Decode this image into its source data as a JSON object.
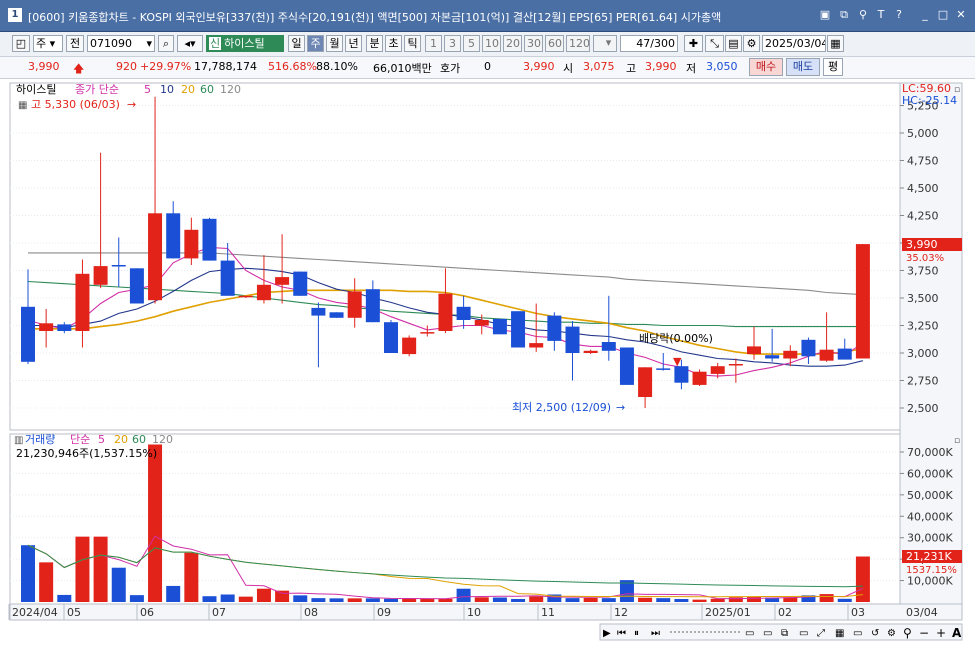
{
  "title_bar": {
    "badge": "1",
    "text": "[0600] 키움종합차트 - KOSPI 외국인보유[337(천)] 주식수[20,191(천)] 액면[500] 자본금[101(억)] 결산[12월] EPS[65] PER[61.64] 시가총액",
    "icons": [
      "window-layout-icon",
      "window-cascade-icon",
      "link-icon",
      "font-icon",
      "help-icon",
      "minimize-icon",
      "maximize-icon",
      "close-icon"
    ]
  },
  "toolbar": {
    "market": "주",
    "prev_label": "전",
    "code": "071090",
    "new_badge": "신",
    "stock_name": "하이스틸",
    "period_tabs": [
      "일",
      "주",
      "월",
      "년"
    ],
    "active_period": "주",
    "minute_tabs": [
      "분",
      "초",
      "틱"
    ],
    "interval_values": [
      "1",
      "3",
      "5",
      "10",
      "20",
      "30",
      "60",
      "120"
    ],
    "count": "47",
    "count_total": "/300",
    "date": "2025/03/04"
  },
  "quote": {
    "price": "3,990",
    "change": "920",
    "change_rate": "+29.97%",
    "volume": "17,788,174",
    "vol_ratio": "516.68%",
    "turnover": "88.10%",
    "amount": "66,010백만",
    "hoga_label": "호가",
    "hoga_value": "0",
    "hoga_price": "3,990",
    "open_label": "시",
    "open": "3,075",
    "high_label": "고",
    "high": "3,990",
    "low_label": "저",
    "low": "3,050",
    "buy_label": "매수",
    "sell_label": "매도",
    "eval_label": "평"
  },
  "price_panel": {
    "stock_label": "하이스틸",
    "ma_prefix": "종가 단순",
    "ma_labels": [
      "5",
      "10",
      "20",
      "60",
      "120"
    ],
    "high_note": "고 5,330 (06/03)",
    "low_note": "최저 2,500 (12/09)",
    "dividend_note": "배당락(0.00%)",
    "lc": "LC:59.60",
    "hc": "HC:-25.14",
    "last_price": "3,990",
    "last_change": "35.03%"
  },
  "volume_panel": {
    "label": "거래량",
    "ma_prefix": "단순",
    "ma_labels": [
      "5",
      "20",
      "60",
      "120"
    ],
    "info": "21,230,946주(1,537.15%)",
    "last_volume": "21,231K",
    "last_ratio": "1537.15%"
  },
  "x_axis": [
    "2024/04",
    "05",
    "06",
    "07",
    "08",
    "09",
    "10",
    "11",
    "12",
    "2025/01",
    "02",
    "03",
    "03/04"
  ],
  "colors": {
    "up": "#e2231a",
    "down": "#1a4fd6",
    "ma5": "#d12fa6",
    "ma10": "#23388c",
    "ma20": "#e0a100",
    "ma60": "#2e8b57",
    "ma120": "#8a8a8a"
  },
  "chart_data": {
    "type": "candlestick",
    "price_axis_ticks": [
      "5,250",
      "5,000",
      "4,750",
      "4,500",
      "4,250",
      "4,000",
      "3,750",
      "3,500",
      "3,250",
      "3,000",
      "2,750",
      "2,500"
    ],
    "volume_axis_ticks": [
      "70,000K",
      "60,000K",
      "50,000K",
      "40,000K",
      "30,000K",
      "20,000K",
      "10,000K"
    ],
    "candles": [
      [
        3420,
        3760,
        2900,
        2920
      ],
      [
        3200,
        3400,
        3050,
        3270
      ],
      [
        3260,
        3280,
        3180,
        3200
      ],
      [
        3200,
        3850,
        3050,
        3720
      ],
      [
        3620,
        4820,
        3590,
        3790
      ],
      [
        3800,
        4050,
        3600,
        3790
      ],
      [
        3770,
        3770,
        3450,
        3450
      ],
      [
        3480,
        5330,
        3450,
        4270
      ],
      [
        4270,
        4380,
        3860,
        3860
      ],
      [
        3860,
        4230,
        3800,
        4120
      ],
      [
        4220,
        4230,
        3840,
        3840
      ],
      [
        3840,
        4000,
        3530,
        3520
      ],
      [
        3510,
        3520,
        3500,
        3520
      ],
      [
        3480,
        3890,
        3450,
        3620
      ],
      [
        3620,
        4080,
        3450,
        3690
      ],
      [
        3740,
        3740,
        3520,
        3520
      ],
      [
        3410,
        3460,
        2870,
        3340
      ],
      [
        3370,
        3370,
        3320,
        3320
      ],
      [
        3320,
        3680,
        3230,
        3560
      ],
      [
        3580,
        3660,
        3280,
        3280
      ],
      [
        3280,
        3300,
        3000,
        3000
      ],
      [
        2990,
        3160,
        2970,
        3140
      ],
      [
        3190,
        3250,
        3150,
        3190
      ],
      [
        3200,
        3770,
        3180,
        3540
      ],
      [
        3420,
        3520,
        3220,
        3300
      ],
      [
        3250,
        3350,
        3170,
        3300
      ],
      [
        3310,
        3310,
        3190,
        3170
      ],
      [
        3380,
        3380,
        3050,
        3050
      ],
      [
        3050,
        3450,
        3010,
        3090
      ],
      [
        3340,
        3370,
        3020,
        3110
      ],
      [
        3240,
        3290,
        2750,
        3000
      ],
      [
        3000,
        3030,
        2990,
        3020
      ],
      [
        3100,
        3520,
        2930,
        3020
      ],
      [
        3050,
        3050,
        2740,
        2710
      ],
      [
        2600,
        2870,
        2500,
        2870
      ],
      [
        2860,
        3000,
        2840,
        2850
      ],
      [
        2880,
        2940,
        2670,
        2730
      ],
      [
        2710,
        2850,
        2700,
        2830
      ],
      [
        2810,
        2910,
        2770,
        2880
      ],
      [
        2900,
        2950,
        2730,
        2900
      ],
      [
        2990,
        3240,
        2940,
        3060
      ],
      [
        2980,
        3220,
        2920,
        2950
      ],
      [
        2950,
        3070,
        2880,
        3020
      ],
      [
        3120,
        3140,
        2900,
        2970
      ],
      [
        2930,
        3370,
        2920,
        3030
      ],
      [
        3040,
        3130,
        2960,
        2940
      ],
      [
        2950,
        3990,
        2950,
        3990
      ]
    ],
    "volumes_k": [
      26500,
      18500,
      3300,
      30500,
      30500,
      16000,
      3200,
      73500,
      7500,
      23000,
      2700,
      3500,
      2500,
      6200,
      5300,
      3100,
      1800,
      1700,
      1700,
      1700,
      1500,
      1500,
      1500,
      1500,
      6200,
      2200,
      2100,
      1400,
      2600,
      3500,
      1800,
      1900,
      1800,
      10200,
      2000,
      1800,
      1400,
      1100,
      1500,
      2200,
      2300,
      2100,
      2200,
      3100,
      3700,
      1500,
      21231
    ],
    "ma5": [
      3300,
      3250,
      3220,
      3310,
      3450,
      3550,
      3580,
      3620,
      3820,
      3900,
      3960,
      3950,
      3750,
      3660,
      3600,
      3570,
      3500,
      3460,
      3440,
      3400,
      3330,
      3270,
      3210,
      3230,
      3250,
      3250,
      3210,
      3190,
      3150,
      3140,
      3080,
      3060,
      3060,
      3000,
      2960,
      2900,
      2870,
      2800,
      2790,
      2800,
      2840,
      2870,
      2910,
      2970,
      3020,
      2980,
      3090
    ],
    "ma10": [
      3250,
      3250,
      3230,
      3260,
      3290,
      3360,
      3400,
      3470,
      3560,
      3660,
      3740,
      3760,
      3770,
      3760,
      3740,
      3710,
      3640,
      3580,
      3550,
      3500,
      3460,
      3410,
      3370,
      3350,
      3330,
      3300,
      3260,
      3240,
      3210,
      3200,
      3180,
      3160,
      3150,
      3120,
      3100,
      3060,
      3010,
      2980,
      2950,
      2940,
      2920,
      2910,
      2890,
      2880,
      2880,
      2890,
      2930
    ],
    "ma20": [
      3220,
      3220,
      3220,
      3220,
      3240,
      3260,
      3290,
      3330,
      3380,
      3420,
      3460,
      3490,
      3520,
      3550,
      3560,
      3570,
      3570,
      3570,
      3570,
      3570,
      3570,
      3560,
      3560,
      3550,
      3520,
      3480,
      3440,
      3400,
      3360,
      3330,
      3310,
      3290,
      3270,
      3230,
      3200,
      3150,
      3110,
      3070,
      3040,
      3010,
      2990,
      2990,
      2990,
      2990,
      2990,
      3010,
      3040
    ],
    "ma60": [
      3650,
      3640,
      3630,
      3620,
      3610,
      3600,
      3590,
      3580,
      3570,
      3560,
      3550,
      3540,
      3520,
      3500,
      3480,
      3460,
      3440,
      3430,
      3410,
      3400,
      3380,
      3370,
      3360,
      3350,
      3340,
      3320,
      3310,
      3300,
      3290,
      3280,
      3280,
      3270,
      3270,
      3260,
      3260,
      3250,
      3250,
      3250,
      3250,
      3240,
      3240,
      3240,
      3240,
      3240,
      3240,
      3240,
      3240
    ],
    "ma120": [
      3910,
      3910,
      3910,
      3910,
      3910,
      3910,
      3910,
      3910,
      3910,
      3910,
      3910,
      3900,
      3890,
      3880,
      3870,
      3860,
      3850,
      3840,
      3830,
      3820,
      3810,
      3800,
      3790,
      3780,
      3770,
      3760,
      3750,
      3740,
      3730,
      3720,
      3710,
      3700,
      3690,
      3670,
      3660,
      3650,
      3640,
      3630,
      3620,
      3610,
      3600,
      3590,
      3580,
      3570,
      3550,
      3540,
      3530
    ]
  }
}
